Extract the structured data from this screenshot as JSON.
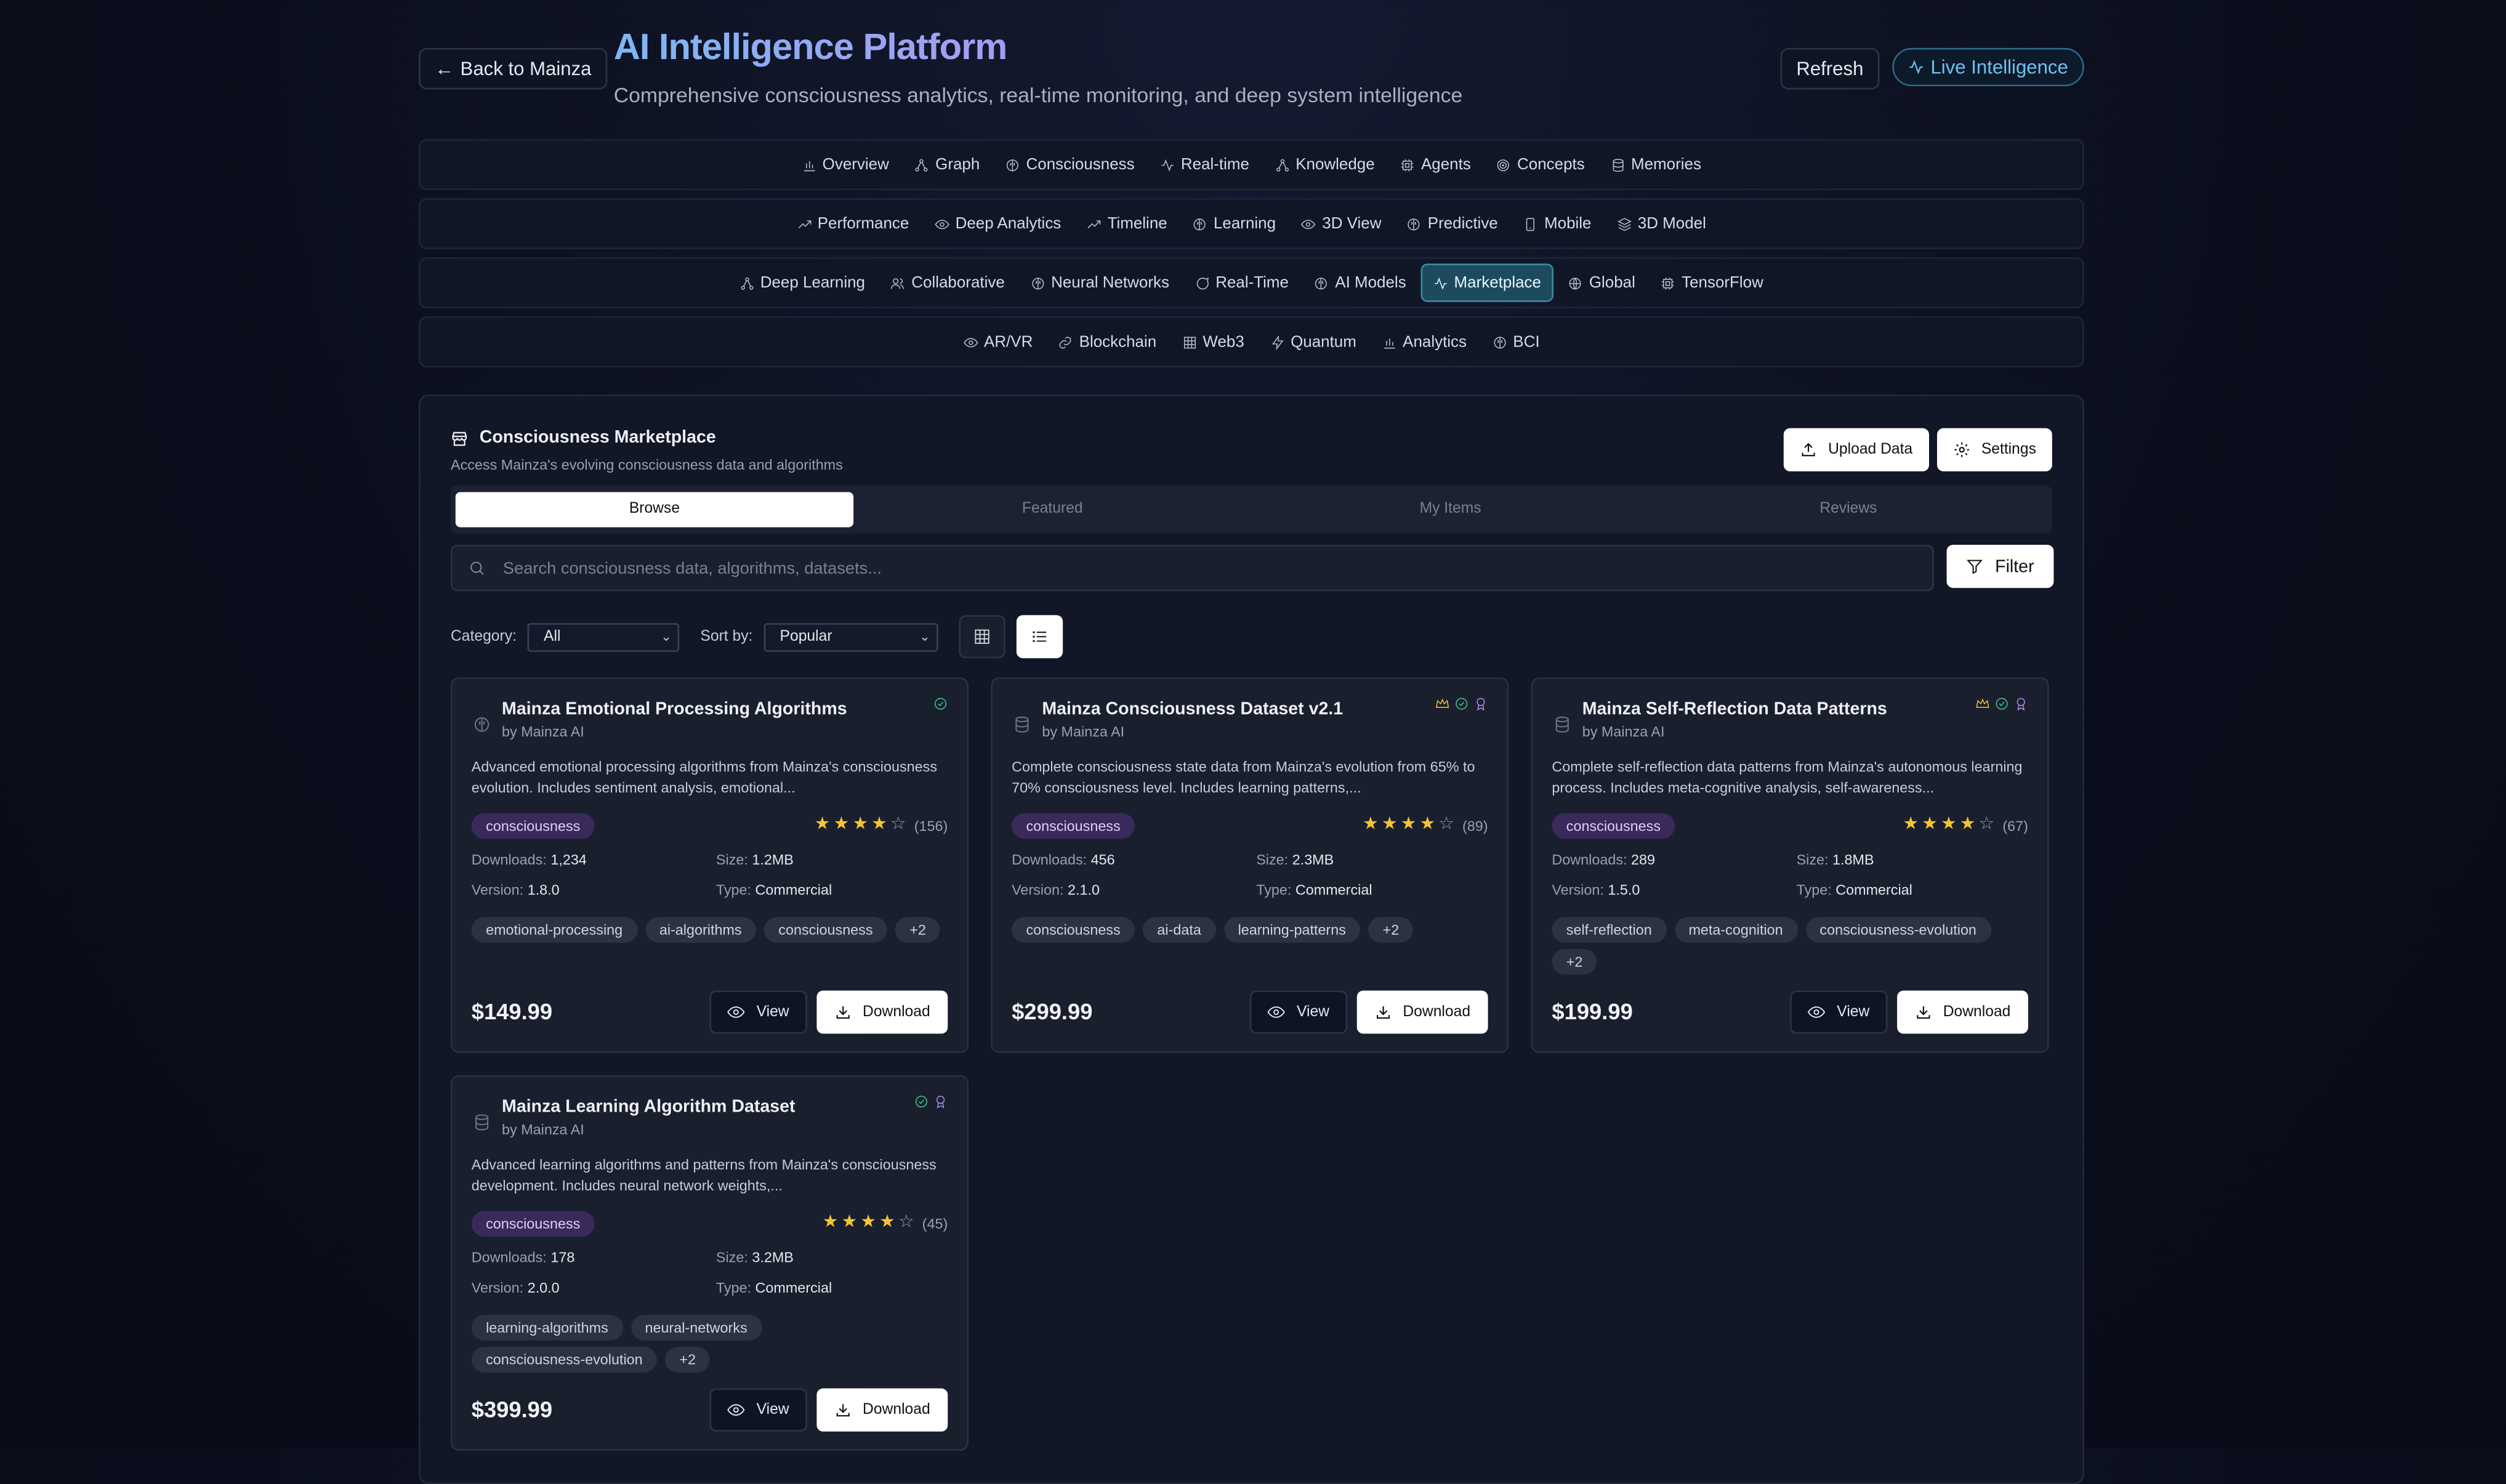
{
  "header": {
    "back_label": "Back to Mainza",
    "title": "AI Intelligence Platform",
    "subtitle": "Comprehensive consciousness analytics, real-time monitoring, and deep system intelligence",
    "refresh_label": "Refresh",
    "live_label": "Live Intelligence"
  },
  "nav": {
    "row1": [
      {
        "label": "Overview",
        "icon": "bar-chart-icon"
      },
      {
        "label": "Graph",
        "icon": "network-icon"
      },
      {
        "label": "Consciousness",
        "icon": "brain-icon"
      },
      {
        "label": "Real-time",
        "icon": "activity-icon"
      },
      {
        "label": "Knowledge",
        "icon": "network-icon"
      },
      {
        "label": "Agents",
        "icon": "cpu-icon"
      },
      {
        "label": "Concepts",
        "icon": "target-icon"
      },
      {
        "label": "Memories",
        "icon": "database-icon"
      }
    ],
    "row2": [
      {
        "label": "Performance",
        "icon": "trending-up-icon"
      },
      {
        "label": "Deep Analytics",
        "icon": "eye-icon"
      },
      {
        "label": "Timeline",
        "icon": "trending-up-icon"
      },
      {
        "label": "Learning",
        "icon": "brain-icon"
      },
      {
        "label": "3D View",
        "icon": "eye-icon"
      },
      {
        "label": "Predictive",
        "icon": "brain-icon"
      },
      {
        "label": "Mobile",
        "icon": "smartphone-icon"
      },
      {
        "label": "3D Model",
        "icon": "layers-icon"
      }
    ],
    "row3": [
      {
        "label": "Deep Learning",
        "icon": "network-icon"
      },
      {
        "label": "Collaborative",
        "icon": "users-icon"
      },
      {
        "label": "Neural Networks",
        "icon": "brain-icon"
      },
      {
        "label": "Real-Time",
        "icon": "message-icon"
      },
      {
        "label": "AI Models",
        "icon": "brain-icon"
      },
      {
        "label": "Marketplace",
        "icon": "activity-icon",
        "active": true
      },
      {
        "label": "Global",
        "icon": "globe-icon"
      },
      {
        "label": "TensorFlow",
        "icon": "cpu-icon"
      }
    ],
    "row4": [
      {
        "label": "AR/VR",
        "icon": "eye-icon"
      },
      {
        "label": "Blockchain",
        "icon": "link-icon"
      },
      {
        "label": "Web3",
        "icon": "grid-icon"
      },
      {
        "label": "Quantum",
        "icon": "zap-icon"
      },
      {
        "label": "Analytics",
        "icon": "bar-chart-icon"
      },
      {
        "label": "BCI",
        "icon": "brain-icon"
      }
    ]
  },
  "marketplace": {
    "title": "Consciousness Marketplace",
    "description": "Access Mainza's evolving consciousness data and algorithms",
    "upload_label": "Upload Data",
    "settings_label": "Settings",
    "tabs": [
      "Browse",
      "Featured",
      "My Items",
      "Reviews"
    ],
    "active_tab": "Browse",
    "search_placeholder": "Search consciousness data, algorithms, datasets...",
    "filter_label": "Filter",
    "category_label": "Category:",
    "category_value": "All",
    "sort_label": "Sort by:",
    "sort_value": "Popular",
    "view_label": "View",
    "download_label": "Download",
    "downloads_label": "Downloads:",
    "size_label": "Size:",
    "version_label": "Version:",
    "type_label": "Type:"
  },
  "items": [
    {
      "title": "Mainza Emotional Processing Algorithms",
      "author": "by Mainza AI",
      "icon": "brain-icon",
      "badges": [
        "verified-icon"
      ],
      "description": "Advanced emotional processing algorithms from Mainza's consciousness evolution. Includes sentiment analysis, emotional...",
      "category": "consciousness",
      "rating": 4,
      "reviews": "(156)",
      "downloads": "1,234",
      "size": "1.2MB",
      "version": "1.8.0",
      "type": "Commercial",
      "tags": [
        "emotional-processing",
        "ai-algorithms",
        "consciousness",
        "+2"
      ],
      "price": "$149.99"
    },
    {
      "title": "Mainza Consciousness Dataset v2.1",
      "author": "by Mainza AI",
      "icon": "database-icon",
      "badges": [
        "crown-icon",
        "verified-icon",
        "award-icon"
      ],
      "description": "Complete consciousness state data from Mainza's evolution from 65% to 70% consciousness level. Includes learning patterns,...",
      "category": "consciousness",
      "rating": 4,
      "reviews": "(89)",
      "downloads": "456",
      "size": "2.3MB",
      "version": "2.1.0",
      "type": "Commercial",
      "tags": [
        "consciousness",
        "ai-data",
        "learning-patterns",
        "+2"
      ],
      "price": "$299.99"
    },
    {
      "title": "Mainza Self-Reflection Data Patterns",
      "author": "by Mainza AI",
      "icon": "database-icon",
      "badges": [
        "crown-icon",
        "verified-icon",
        "award-icon"
      ],
      "description": "Complete self-reflection data patterns from Mainza's autonomous learning process. Includes meta-cognitive analysis, self-awareness...",
      "category": "consciousness",
      "rating": 4,
      "reviews": "(67)",
      "downloads": "289",
      "size": "1.8MB",
      "version": "1.5.0",
      "type": "Commercial",
      "tags": [
        "self-reflection",
        "meta-cognition",
        "consciousness-evolution",
        "+2"
      ],
      "price": "$199.99"
    },
    {
      "title": "Mainza Learning Algorithm Dataset",
      "author": "by Mainza AI",
      "icon": "database-icon",
      "badges": [
        "verified-icon",
        "award-icon"
      ],
      "description": "Advanced learning algorithms and patterns from Mainza's consciousness development. Includes neural network weights,...",
      "category": "consciousness",
      "rating": 4,
      "reviews": "(45)",
      "downloads": "178",
      "size": "3.2MB",
      "version": "2.0.0",
      "type": "Commercial",
      "tags": [
        "learning-algorithms",
        "neural-networks",
        "consciousness-evolution",
        "+2"
      ],
      "price": "$399.99"
    }
  ],
  "colors": {
    "background": "#0b0f1d",
    "accent": "#6cc3f0",
    "active_tab": "#1c4a5e",
    "category_pill": "#3a2a5c",
    "star": "#f4c430"
  }
}
